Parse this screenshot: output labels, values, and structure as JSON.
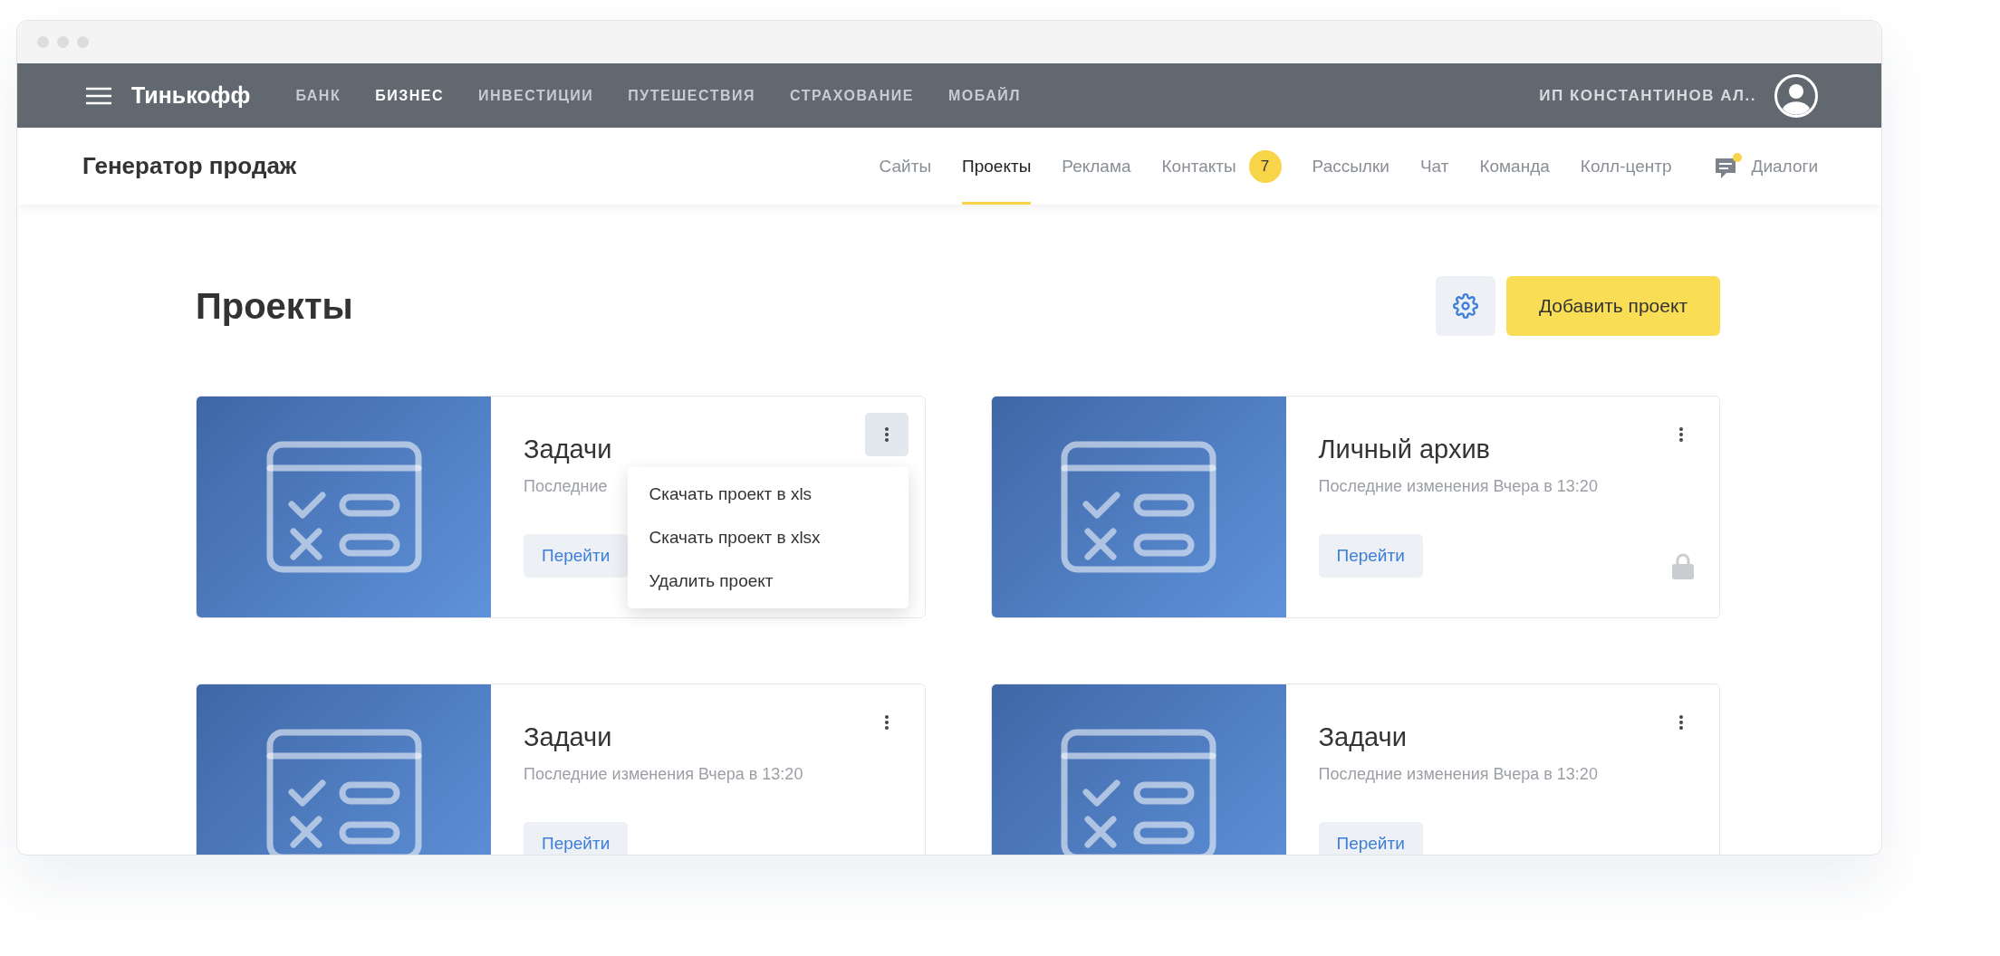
{
  "topnav": {
    "logo": "Тинькофф",
    "items": [
      {
        "label": "БАНК",
        "selected": false
      },
      {
        "label": "БИЗНЕС",
        "selected": true
      },
      {
        "label": "ИНВЕСТИЦИИ",
        "selected": false
      },
      {
        "label": "ПУТЕШЕСТВИЯ",
        "selected": false
      },
      {
        "label": "СТРАХОВАНИЕ",
        "selected": false
      },
      {
        "label": "МОБАЙЛ",
        "selected": false
      }
    ],
    "user": "ИП КОНСТАНТИНОВ АЛ.."
  },
  "subnav": {
    "title": "Генератор продаж",
    "tabs": [
      {
        "label": "Сайты",
        "selected": false
      },
      {
        "label": "Проекты",
        "selected": true
      },
      {
        "label": "Реклама",
        "selected": false
      },
      {
        "label": "Контакты",
        "selected": false,
        "badge": "7"
      },
      {
        "label": "Рассылки",
        "selected": false
      },
      {
        "label": "Чат",
        "selected": false
      },
      {
        "label": "Команда",
        "selected": false
      },
      {
        "label": "Колл-центр",
        "selected": false
      }
    ],
    "dialogs": {
      "label": "Диалоги",
      "unread": true
    }
  },
  "page": {
    "title": "Проекты",
    "add_button": "Добавить проект"
  },
  "cards": [
    {
      "title": "Задачи",
      "subtitle": "Последние",
      "button": "Перейти",
      "locked": false,
      "menu_open": true,
      "menu": [
        "Скачать проект в xls",
        "Скачать проект в xlsx",
        "Удалить проект"
      ]
    },
    {
      "title": "Личный архив",
      "subtitle": "Последние изменения Вчера в 13:20",
      "button": "Перейти",
      "locked": true,
      "menu_open": false
    },
    {
      "title": "Задачи",
      "subtitle": "Последние изменения Вчера в 13:20",
      "button": "Перейти",
      "locked": false,
      "menu_open": false
    },
    {
      "title": "Задачи",
      "subtitle": "Последние изменения Вчера в 13:20",
      "button": "Перейти",
      "locked": false,
      "menu_open": false
    }
  ]
}
